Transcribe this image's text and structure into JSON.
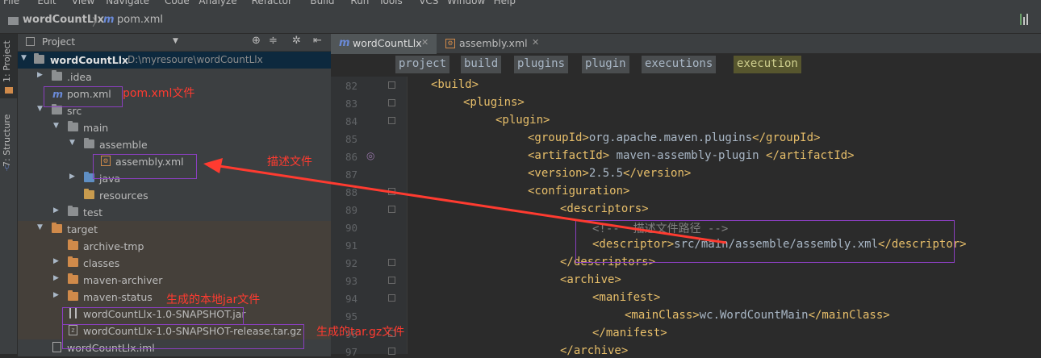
{
  "menu": [
    "File",
    "Edit",
    "View",
    "Navigate",
    "Code",
    "Analyze",
    "Refactor",
    "Build",
    "Run",
    "Tools",
    "VCS",
    "Window",
    "Help"
  ],
  "navbar": {
    "project": "wordCountLlx",
    "separator": "〉",
    "file": "pom.xml",
    "file_icon": "m"
  },
  "toolwindows": {
    "project": "1: Project",
    "structure": "7: Structure"
  },
  "project_panel": {
    "title": "Project",
    "tree": [
      {
        "label": "wordCountLlx",
        "path": "D:\\myresoure\\wordCountLlx"
      },
      {
        "label": ".idea"
      },
      {
        "label": "pom.xml"
      },
      {
        "label": "src"
      },
      {
        "label": "main"
      },
      {
        "label": "assemble"
      },
      {
        "label": "assembly.xml"
      },
      {
        "label": "java"
      },
      {
        "label": "resources"
      },
      {
        "label": "test"
      },
      {
        "label": "target"
      },
      {
        "label": "archive-tmp"
      },
      {
        "label": "classes"
      },
      {
        "label": "maven-archiver"
      },
      {
        "label": "maven-status"
      },
      {
        "label": "wordCountLlx-1.0-SNAPSHOT.jar"
      },
      {
        "label": "wordCountLlx-1.0-SNAPSHOT-release.tar.gz"
      },
      {
        "label": "wordCountLlx.iml"
      }
    ]
  },
  "editor": {
    "tabs": [
      {
        "label": "wordCountLlx",
        "icon": "m",
        "active": true
      },
      {
        "label": "assembly.xml",
        "active": false
      }
    ],
    "breadcrumbs": [
      "project",
      "build",
      "plugins",
      "plugin",
      "executions",
      "execution"
    ],
    "lines": [
      {
        "n": "82",
        "tokens": [
          [
            "tg",
            "<build>"
          ]
        ]
      },
      {
        "n": "83",
        "tokens": [
          [
            "tg",
            "<plugins>"
          ]
        ]
      },
      {
        "n": "84",
        "tokens": [
          [
            "tg",
            "<plugin>"
          ]
        ]
      },
      {
        "n": "85",
        "tokens": [
          [
            "tg",
            "<groupId>"
          ],
          [
            "tx",
            "org.apache.maven.plugins"
          ],
          [
            "tg",
            "</groupId>"
          ]
        ]
      },
      {
        "n": "86",
        "tokens": [
          [
            "tg",
            "<artifactId>"
          ],
          [
            "tx",
            " maven-assembly-plugin "
          ],
          [
            "tg",
            "</artifactId>"
          ]
        ]
      },
      {
        "n": "87",
        "tokens": [
          [
            "tg",
            "<version>"
          ],
          [
            "tx",
            "2.5.5"
          ],
          [
            "tg",
            "</version>"
          ]
        ]
      },
      {
        "n": "88",
        "tokens": [
          [
            "tg",
            "<configuration>"
          ]
        ]
      },
      {
        "n": "89",
        "tokens": [
          [
            "tg",
            "<descriptors>"
          ]
        ]
      },
      {
        "n": "90",
        "tokens": [
          [
            "cm",
            "<!--  描述文件路径 -->"
          ]
        ]
      },
      {
        "n": "91",
        "tokens": [
          [
            "tg",
            "<descriptor>"
          ],
          [
            "tx",
            "src/main/assemble/assembly.xml"
          ],
          [
            "tg",
            "</descriptor>"
          ]
        ]
      },
      {
        "n": "92",
        "tokens": [
          [
            "tg",
            "</descriptors>"
          ]
        ]
      },
      {
        "n": "93",
        "tokens": [
          [
            "tg",
            "<archive>"
          ]
        ]
      },
      {
        "n": "94",
        "tokens": [
          [
            "tg",
            "<manifest>"
          ]
        ]
      },
      {
        "n": "95",
        "tokens": [
          [
            "tg",
            "<mainClass>"
          ],
          [
            "tx",
            "wc.WordCountMain"
          ],
          [
            "tg",
            "</mainClass>"
          ]
        ]
      },
      {
        "n": "96",
        "tokens": [
          [
            "tg",
            "</manifest>"
          ]
        ]
      },
      {
        "n": "97",
        "tokens": [
          [
            "tg",
            "</archive>"
          ]
        ]
      }
    ]
  },
  "annotations": {
    "pom": "pom.xml文件",
    "descriptor": "描述文件",
    "jar": "生成的本地jar文件",
    "targz": "生成的tar.gz文件"
  },
  "colors": {
    "annotation": "#ff3b30",
    "highlight_box": "#8a3fbf",
    "xml_tag": "#e8bf6a",
    "text": "#a9b7c6",
    "comment": "#808080"
  }
}
